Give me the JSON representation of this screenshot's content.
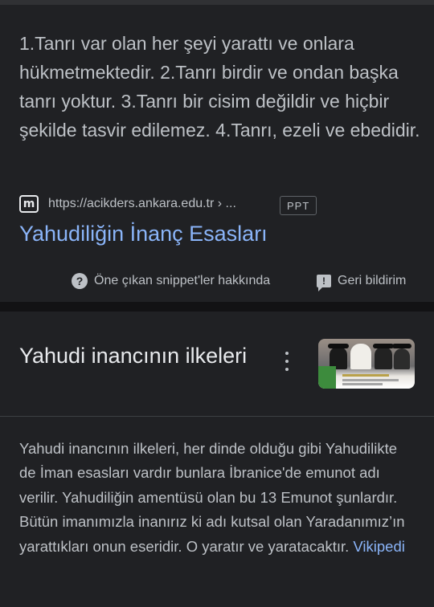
{
  "featured_snippet": {
    "text": "1.Tanrı var olan her şeyi yarattı ve onlara hükmetmektedir. 2.Tanrı birdir ve ondan başka tanrı yoktur. 3.Tanrı bir cisim değildir ve hiçbir şekilde tasvir edilemez. 4.Tanrı, ezeli ve ebedidir.",
    "source_url": "https://acikders.ankara.edu.tr › ...",
    "file_badge": "PPT",
    "favicon_icon": "ankara-university-logo-icon",
    "favicon_glyph": "m",
    "title": "Yahudiliğin İnanç Esasları",
    "about_label": "Öne çıkan snippet'ler hakkında",
    "feedback_label": "Geri bildirim",
    "help_glyph": "?",
    "feedback_glyph": "!"
  },
  "knowledge_card": {
    "title": "Yahudi inancının ilkeleri",
    "body": "Yahudi inancının ilkeleri, her dinde olduğu gibi Yahudilikte de İman esasları vardır bunlara İbranice'de emunot adı verilir. Yahudiliğin amentüsü olan bu 13 Emunot şunlardır. Bütün imanımızla inanırız ki adı kutsal olan Yaradanımız’ın yarattıkları onun eseridir. O yaratır ve yaratacaktır.",
    "link_label": "Vikipedi",
    "thumbnail_icon": "religious-men-photo-thumbnail",
    "menu_icon": "more-vert-icon"
  },
  "colors": {
    "background": "#202124",
    "link": "#8ab4f8",
    "text": "#bdc1c6"
  }
}
